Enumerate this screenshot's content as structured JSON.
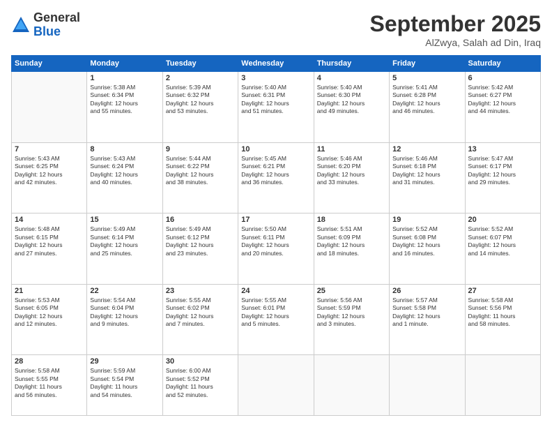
{
  "logo": {
    "general": "General",
    "blue": "Blue"
  },
  "header": {
    "month": "September 2025",
    "location": "AlZwya, Salah ad Din, Iraq"
  },
  "weekdays": [
    "Sunday",
    "Monday",
    "Tuesday",
    "Wednesday",
    "Thursday",
    "Friday",
    "Saturday"
  ],
  "weeks": [
    [
      {
        "day": "",
        "content": ""
      },
      {
        "day": "1",
        "content": "Sunrise: 5:38 AM\nSunset: 6:34 PM\nDaylight: 12 hours\nand 55 minutes."
      },
      {
        "day": "2",
        "content": "Sunrise: 5:39 AM\nSunset: 6:32 PM\nDaylight: 12 hours\nand 53 minutes."
      },
      {
        "day": "3",
        "content": "Sunrise: 5:40 AM\nSunset: 6:31 PM\nDaylight: 12 hours\nand 51 minutes."
      },
      {
        "day": "4",
        "content": "Sunrise: 5:40 AM\nSunset: 6:30 PM\nDaylight: 12 hours\nand 49 minutes."
      },
      {
        "day": "5",
        "content": "Sunrise: 5:41 AM\nSunset: 6:28 PM\nDaylight: 12 hours\nand 46 minutes."
      },
      {
        "day": "6",
        "content": "Sunrise: 5:42 AM\nSunset: 6:27 PM\nDaylight: 12 hours\nand 44 minutes."
      }
    ],
    [
      {
        "day": "7",
        "content": "Sunrise: 5:43 AM\nSunset: 6:25 PM\nDaylight: 12 hours\nand 42 minutes."
      },
      {
        "day": "8",
        "content": "Sunrise: 5:43 AM\nSunset: 6:24 PM\nDaylight: 12 hours\nand 40 minutes."
      },
      {
        "day": "9",
        "content": "Sunrise: 5:44 AM\nSunset: 6:22 PM\nDaylight: 12 hours\nand 38 minutes."
      },
      {
        "day": "10",
        "content": "Sunrise: 5:45 AM\nSunset: 6:21 PM\nDaylight: 12 hours\nand 36 minutes."
      },
      {
        "day": "11",
        "content": "Sunrise: 5:46 AM\nSunset: 6:20 PM\nDaylight: 12 hours\nand 33 minutes."
      },
      {
        "day": "12",
        "content": "Sunrise: 5:46 AM\nSunset: 6:18 PM\nDaylight: 12 hours\nand 31 minutes."
      },
      {
        "day": "13",
        "content": "Sunrise: 5:47 AM\nSunset: 6:17 PM\nDaylight: 12 hours\nand 29 minutes."
      }
    ],
    [
      {
        "day": "14",
        "content": "Sunrise: 5:48 AM\nSunset: 6:15 PM\nDaylight: 12 hours\nand 27 minutes."
      },
      {
        "day": "15",
        "content": "Sunrise: 5:49 AM\nSunset: 6:14 PM\nDaylight: 12 hours\nand 25 minutes."
      },
      {
        "day": "16",
        "content": "Sunrise: 5:49 AM\nSunset: 6:12 PM\nDaylight: 12 hours\nand 23 minutes."
      },
      {
        "day": "17",
        "content": "Sunrise: 5:50 AM\nSunset: 6:11 PM\nDaylight: 12 hours\nand 20 minutes."
      },
      {
        "day": "18",
        "content": "Sunrise: 5:51 AM\nSunset: 6:09 PM\nDaylight: 12 hours\nand 18 minutes."
      },
      {
        "day": "19",
        "content": "Sunrise: 5:52 AM\nSunset: 6:08 PM\nDaylight: 12 hours\nand 16 minutes."
      },
      {
        "day": "20",
        "content": "Sunrise: 5:52 AM\nSunset: 6:07 PM\nDaylight: 12 hours\nand 14 minutes."
      }
    ],
    [
      {
        "day": "21",
        "content": "Sunrise: 5:53 AM\nSunset: 6:05 PM\nDaylight: 12 hours\nand 12 minutes."
      },
      {
        "day": "22",
        "content": "Sunrise: 5:54 AM\nSunset: 6:04 PM\nDaylight: 12 hours\nand 9 minutes."
      },
      {
        "day": "23",
        "content": "Sunrise: 5:55 AM\nSunset: 6:02 PM\nDaylight: 12 hours\nand 7 minutes."
      },
      {
        "day": "24",
        "content": "Sunrise: 5:55 AM\nSunset: 6:01 PM\nDaylight: 12 hours\nand 5 minutes."
      },
      {
        "day": "25",
        "content": "Sunrise: 5:56 AM\nSunset: 5:59 PM\nDaylight: 12 hours\nand 3 minutes."
      },
      {
        "day": "26",
        "content": "Sunrise: 5:57 AM\nSunset: 5:58 PM\nDaylight: 12 hours\nand 1 minute."
      },
      {
        "day": "27",
        "content": "Sunrise: 5:58 AM\nSunset: 5:56 PM\nDaylight: 11 hours\nand 58 minutes."
      }
    ],
    [
      {
        "day": "28",
        "content": "Sunrise: 5:58 AM\nSunset: 5:55 PM\nDaylight: 11 hours\nand 56 minutes."
      },
      {
        "day": "29",
        "content": "Sunrise: 5:59 AM\nSunset: 5:54 PM\nDaylight: 11 hours\nand 54 minutes."
      },
      {
        "day": "30",
        "content": "Sunrise: 6:00 AM\nSunset: 5:52 PM\nDaylight: 11 hours\nand 52 minutes."
      },
      {
        "day": "",
        "content": ""
      },
      {
        "day": "",
        "content": ""
      },
      {
        "day": "",
        "content": ""
      },
      {
        "day": "",
        "content": ""
      }
    ]
  ]
}
